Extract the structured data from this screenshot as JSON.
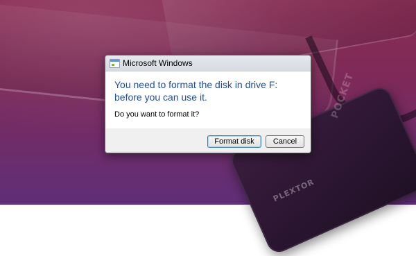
{
  "dialog": {
    "title": "Microsoft Windows",
    "instruction": "You need to format the disk in drive F: before you can use it.",
    "question": "Do you want to format it?",
    "buttons": {
      "primary": "Format disk",
      "cancel": "Cancel"
    },
    "icon": "window-app-icon"
  },
  "background": {
    "drive_label_vertical": "POCKET",
    "drive_brand": "PLEXTOR"
  }
}
